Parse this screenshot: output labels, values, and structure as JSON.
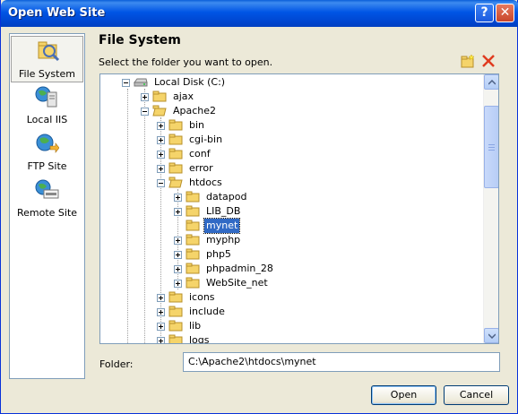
{
  "window": {
    "title": "Open Web Site",
    "help_glyph": "?",
    "close_glyph": "✕"
  },
  "sidebar": {
    "items": [
      {
        "label": "File System",
        "icon": "file-system-icon"
      },
      {
        "label": "Local IIS",
        "icon": "local-iis-icon"
      },
      {
        "label": "FTP Site",
        "icon": "ftp-site-icon"
      },
      {
        "label": "Remote Site",
        "icon": "remote-site-icon"
      }
    ]
  },
  "main": {
    "heading": "File System",
    "subheading": "Select the folder you want to open."
  },
  "tree": {
    "rows": [
      {
        "label": "Local Disk (C:)",
        "expander": "minus",
        "icon": "drive-icon",
        "selected": false
      },
      {
        "label": "ajax",
        "expander": "plus",
        "icon": "folder-icon",
        "selected": false
      },
      {
        "label": "Apache2",
        "expander": "minus",
        "icon": "folder-icon",
        "selected": false
      },
      {
        "label": "bin",
        "expander": "plus",
        "icon": "folder-icon",
        "selected": false
      },
      {
        "label": "cgi-bin",
        "expander": "plus",
        "icon": "folder-icon",
        "selected": false
      },
      {
        "label": "conf",
        "expander": "plus",
        "icon": "folder-icon",
        "selected": false
      },
      {
        "label": "error",
        "expander": "plus",
        "icon": "folder-icon",
        "selected": false
      },
      {
        "label": "htdocs",
        "expander": "minus",
        "icon": "folder-icon",
        "selected": false
      },
      {
        "label": "datapod",
        "expander": "plus",
        "icon": "folder-icon",
        "selected": false
      },
      {
        "label": "LIB_DB",
        "expander": "plus",
        "icon": "folder-icon",
        "selected": false
      },
      {
        "label": "mynet",
        "expander": "none",
        "icon": "folder-icon",
        "selected": true
      },
      {
        "label": "myphp",
        "expander": "plus",
        "icon": "folder-icon",
        "selected": false
      },
      {
        "label": "php5",
        "expander": "plus",
        "icon": "folder-icon",
        "selected": false
      },
      {
        "label": "phpadmin_28",
        "expander": "plus",
        "icon": "folder-icon",
        "selected": false
      },
      {
        "label": "WebSite_net",
        "expander": "plus",
        "icon": "folder-icon",
        "selected": false
      },
      {
        "label": "icons",
        "expander": "plus",
        "icon": "folder-icon",
        "selected": false
      },
      {
        "label": "include",
        "expander": "plus",
        "icon": "folder-icon",
        "selected": false
      },
      {
        "label": "lib",
        "expander": "plus",
        "icon": "folder-icon",
        "selected": false
      },
      {
        "label": "logs",
        "expander": "plus",
        "icon": "folder-icon",
        "selected": false
      }
    ]
  },
  "folder": {
    "label": "Folder:",
    "value": "C:\\Apache2\\htdocs\\mynet"
  },
  "buttons": {
    "open": "Open",
    "cancel": "Cancel"
  },
  "colors": {
    "title_bar": "#0055e5",
    "selection": "#316ac5",
    "folder": "#f5d46a"
  }
}
